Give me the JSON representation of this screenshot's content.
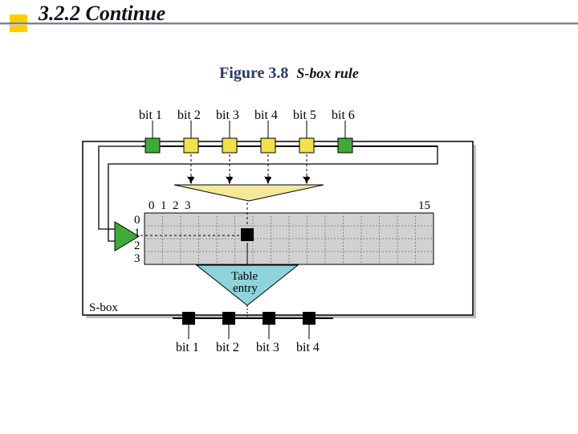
{
  "heading": "3.2.2  Continue",
  "caption_fig": "Figure 3.8",
  "caption_sub": "S-box rule",
  "bits_in": [
    "bit 1",
    "bit 2",
    "bit 3",
    "bit 4",
    "bit 5",
    "bit 6"
  ],
  "bits_out": [
    "bit 1",
    "bit 2",
    "bit 3",
    "bit 4"
  ],
  "col_ticks": [
    "0",
    "1",
    "2",
    "3",
    "15"
  ],
  "row_ticks": [
    "0",
    "1",
    "2",
    "3"
  ],
  "table_entry": "Table\nentry",
  "sbox_label": "S-box",
  "chart_data": {
    "type": "table",
    "title": "S-box rule",
    "inputs": 6,
    "outputs": 4,
    "row_selector_bits": [
      1,
      6
    ],
    "col_selector_bits": [
      2,
      3,
      4,
      5
    ],
    "rows": 4,
    "cols": 16,
    "row_labels": [
      0,
      1,
      2,
      3
    ],
    "col_labels_shown": [
      0,
      1,
      2,
      3,
      15
    ]
  }
}
